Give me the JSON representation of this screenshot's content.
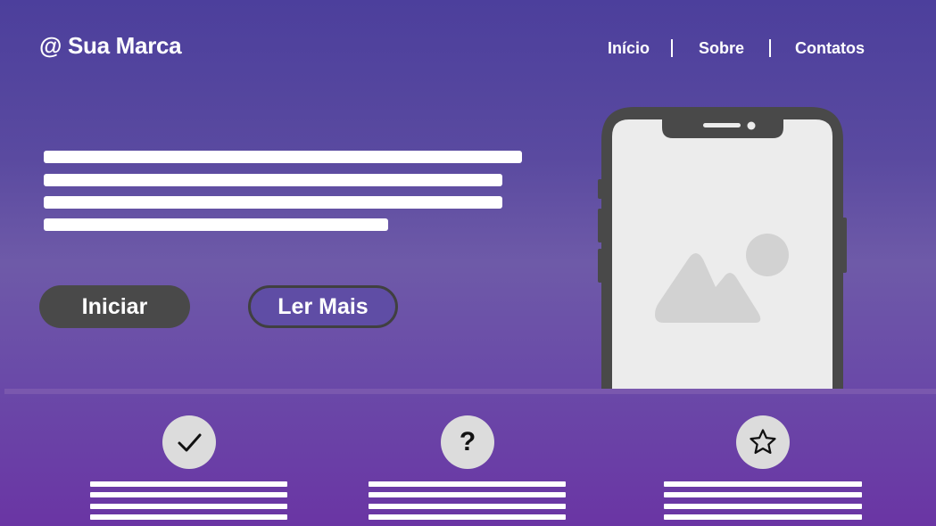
{
  "brand": {
    "text": "@ Sua Marca"
  },
  "nav": {
    "items": [
      {
        "label": "Início"
      },
      {
        "label": "Sobre"
      },
      {
        "label": "Contatos"
      }
    ]
  },
  "hero": {
    "primary_button": "Iniciar",
    "secondary_button": "Ler Mais"
  },
  "phone": {
    "image_icon": "image-placeholder-icon"
  },
  "features": [
    {
      "icon": "check-icon"
    },
    {
      "icon": "question-icon",
      "glyph": "?"
    },
    {
      "icon": "star-icon"
    }
  ],
  "colors": {
    "background_top": "#4c3f9c",
    "background_bottom": "#6a35a4",
    "button_dark": "#494949",
    "phone_frame": "#494949",
    "phone_screen": "#ececec"
  }
}
